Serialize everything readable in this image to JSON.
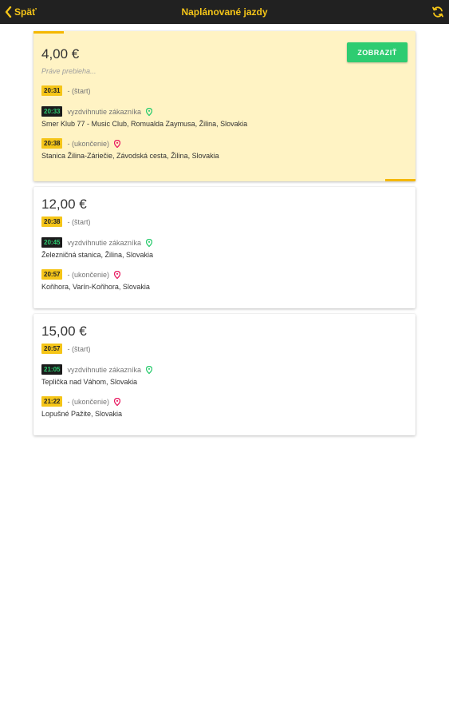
{
  "header": {
    "back_label": "Späť",
    "title": "Naplánované jazdy"
  },
  "rides": [
    {
      "price": "4,00 €",
      "status": "Práve prebieha...",
      "button_label": "ZOBRAZIŤ",
      "start_time": "20:31",
      "start_label": "- (štart)",
      "pickup_time": "20:33",
      "pickup_label": "vyzdvihnutie zákazníka",
      "pickup_address": "Smer Klub 77 - Music Club, Romualda Zaymusa, Žilina, Slovakia",
      "end_time": "20:38",
      "end_label": "- (ukončenie)",
      "end_address": "Stanica Žilina-Záriečie, Závodská cesta, Žilina, Slovakia"
    },
    {
      "price": "12,00 €",
      "start_time": "20:38",
      "start_label": "- (štart)",
      "pickup_time": "20:45",
      "pickup_label": "vyzdvihnutie zákazníka",
      "pickup_address": "Železničná stanica, Žilina, Slovakia",
      "end_time": "20:57",
      "end_label": "- (ukončenie)",
      "end_address": "Koňhora, Varín-Koňhora, Slovakia"
    },
    {
      "price": "15,00 €",
      "start_time": "20:57",
      "start_label": "- (štart)",
      "pickup_time": "21:05",
      "pickup_label": "vyzdvihnutie zákazníka",
      "pickup_address": "Teplička nad Váhom, Slovakia",
      "end_time": "21:22",
      "end_label": "- (ukončenie)",
      "end_address": "Lopušné Pažite, Slovakia"
    }
  ],
  "colors": {
    "accent": "#f5c518",
    "active_card": "#fff3c4",
    "button_green": "#2ecc71",
    "pickup_pin": "#2ecc71",
    "end_pin": "#e91e63"
  },
  "icons": {
    "back": "chevron-left-icon",
    "refresh": "refresh-icon",
    "pickup": "map-pin-icon",
    "dropoff": "map-pin-icon"
  }
}
